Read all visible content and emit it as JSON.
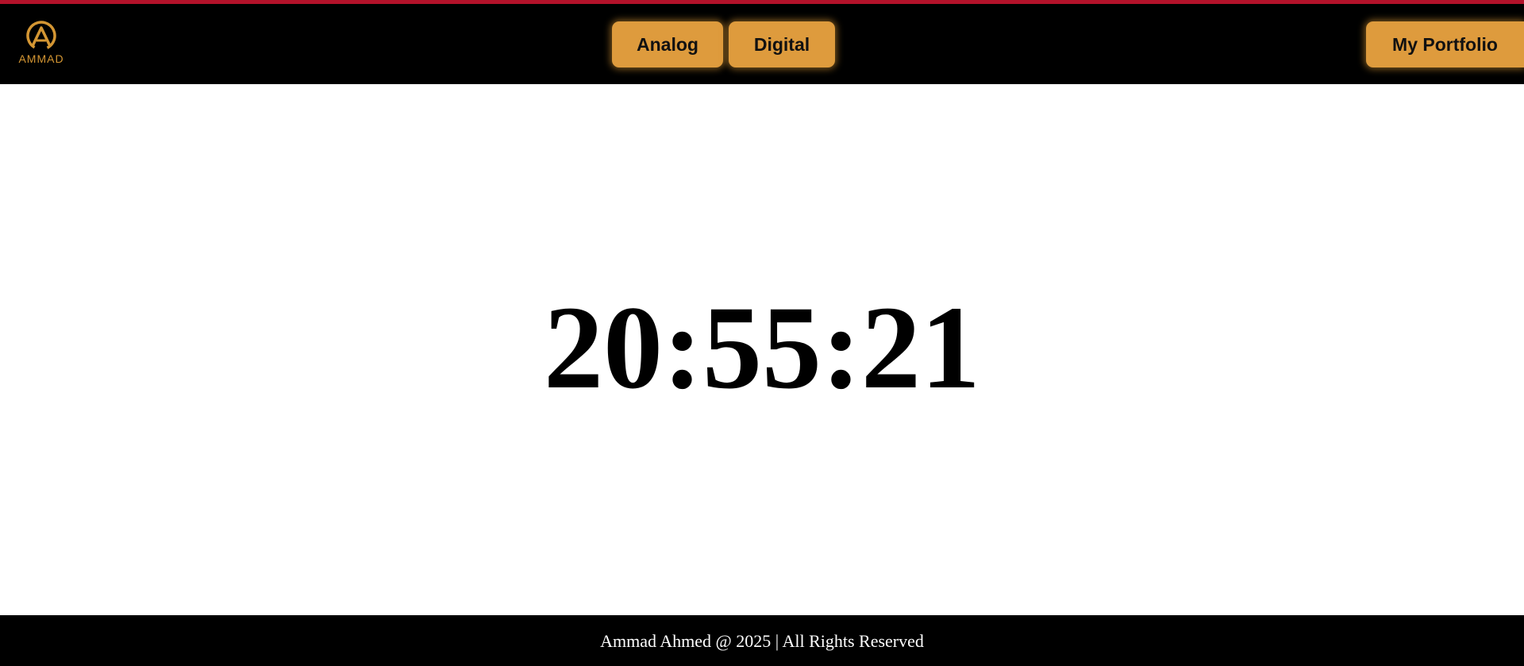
{
  "header": {
    "logo": {
      "icon": "ammad-logo-icon",
      "text": "AMMAD",
      "color": "#d49633"
    },
    "nav": {
      "analog_label": "Analog",
      "digital_label": "Digital",
      "portfolio_label": "My Portfolio"
    },
    "button_color": "#de9b3d",
    "accent_line_color": "#b3122a"
  },
  "main": {
    "clock_time": "20:55:21"
  },
  "footer": {
    "text": "Ammad Ahmed @ 2025 | All Rights Reserved"
  }
}
